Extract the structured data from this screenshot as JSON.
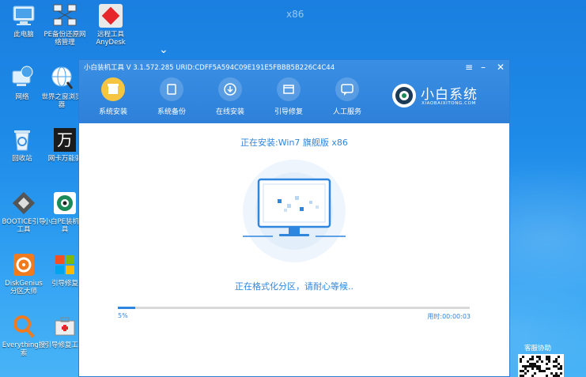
{
  "desktop": {
    "arch_label": "x86",
    "icons": [
      {
        "label": "此电脑"
      },
      {
        "label": "PE备份还原网络管理"
      },
      {
        "label": "远程工具AnyDesk"
      },
      {
        "label": "网络"
      },
      {
        "label": "世界之窗浏览器"
      },
      {
        "label": "回收站"
      },
      {
        "label": "网卡万能驱"
      },
      {
        "label": "BOOTICE引导工具"
      },
      {
        "label": "小白PE装机工具"
      },
      {
        "label": "DiskGenius分区大师"
      },
      {
        "label": "引导修复"
      },
      {
        "label": "Everything搜索"
      },
      {
        "label": "引导修复工具"
      }
    ],
    "help_label": "客服协助"
  },
  "window": {
    "title": "小白装机工具 V 3.1.572.285 URID:CDFF5A594C09E191E5FBBB5B226C4C44",
    "controls": {
      "menu": "≡",
      "minimize": "–",
      "close": "✕"
    },
    "tabs": [
      {
        "label": "系统安装",
        "active": true
      },
      {
        "label": "系统备份",
        "active": false
      },
      {
        "label": "在线安装",
        "active": false
      },
      {
        "label": "引导修复",
        "active": false
      },
      {
        "label": "人工服务",
        "active": false
      }
    ],
    "brand": {
      "name": "小白系统",
      "sub": "XIAOBAIXITONG.COM"
    }
  },
  "install": {
    "title": "正在安装:Win7 旗舰版 x86",
    "status": "正在格式化分区，请耐心等候..",
    "progress_percent": 5,
    "progress_label": "5%",
    "elapsed": "用时:00:00:03"
  },
  "colors": {
    "accent": "#2f86de",
    "header": "#2e80d8",
    "active_tab": "#f5c542"
  }
}
